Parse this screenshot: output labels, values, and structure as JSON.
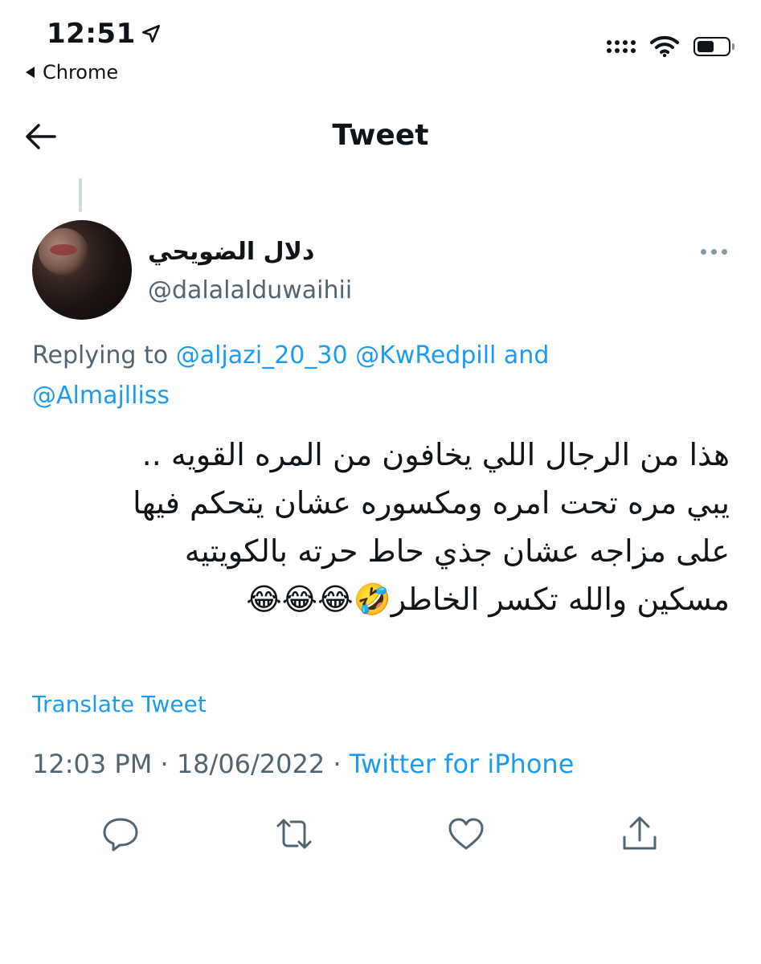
{
  "status_bar": {
    "time": "12:51",
    "back_app": "Chrome"
  },
  "header": {
    "title": "Tweet"
  },
  "tweet": {
    "display_name": "دلال الضويحي",
    "handle": "@dalalalduwaihii",
    "replying_prefix": "Replying to",
    "mentions": [
      "@aljazi_20_30",
      "@KwRedpill",
      "@Almajlliss"
    ],
    "mention_joiner": "and",
    "text_lines": [
      "هذا من الرجال اللي يخافون من المره القويه ..",
      "يبي مره تحت امره ومكسوره عشان يتحكم فيها",
      "على مزاجه عشان جذي حاط حرته بالكويتيه",
      "مسكين والله تكسر الخاطر🤣😂😂😂"
    ],
    "translate_label": "Translate Tweet",
    "time": "12:03 PM",
    "date": "18/06/2022",
    "separator": "·",
    "source": "Twitter for iPhone"
  },
  "icons": {
    "location_arrow": "location-arrow-icon",
    "back_arrow": "back-arrow-icon",
    "more": "more-horizontal-icon",
    "reply": "reply-icon",
    "retweet": "retweet-icon",
    "like": "heart-icon",
    "share": "share-icon"
  },
  "colors": {
    "accent": "#1d9bf0",
    "secondary_text": "#536471",
    "primary_text": "#0f1419"
  }
}
